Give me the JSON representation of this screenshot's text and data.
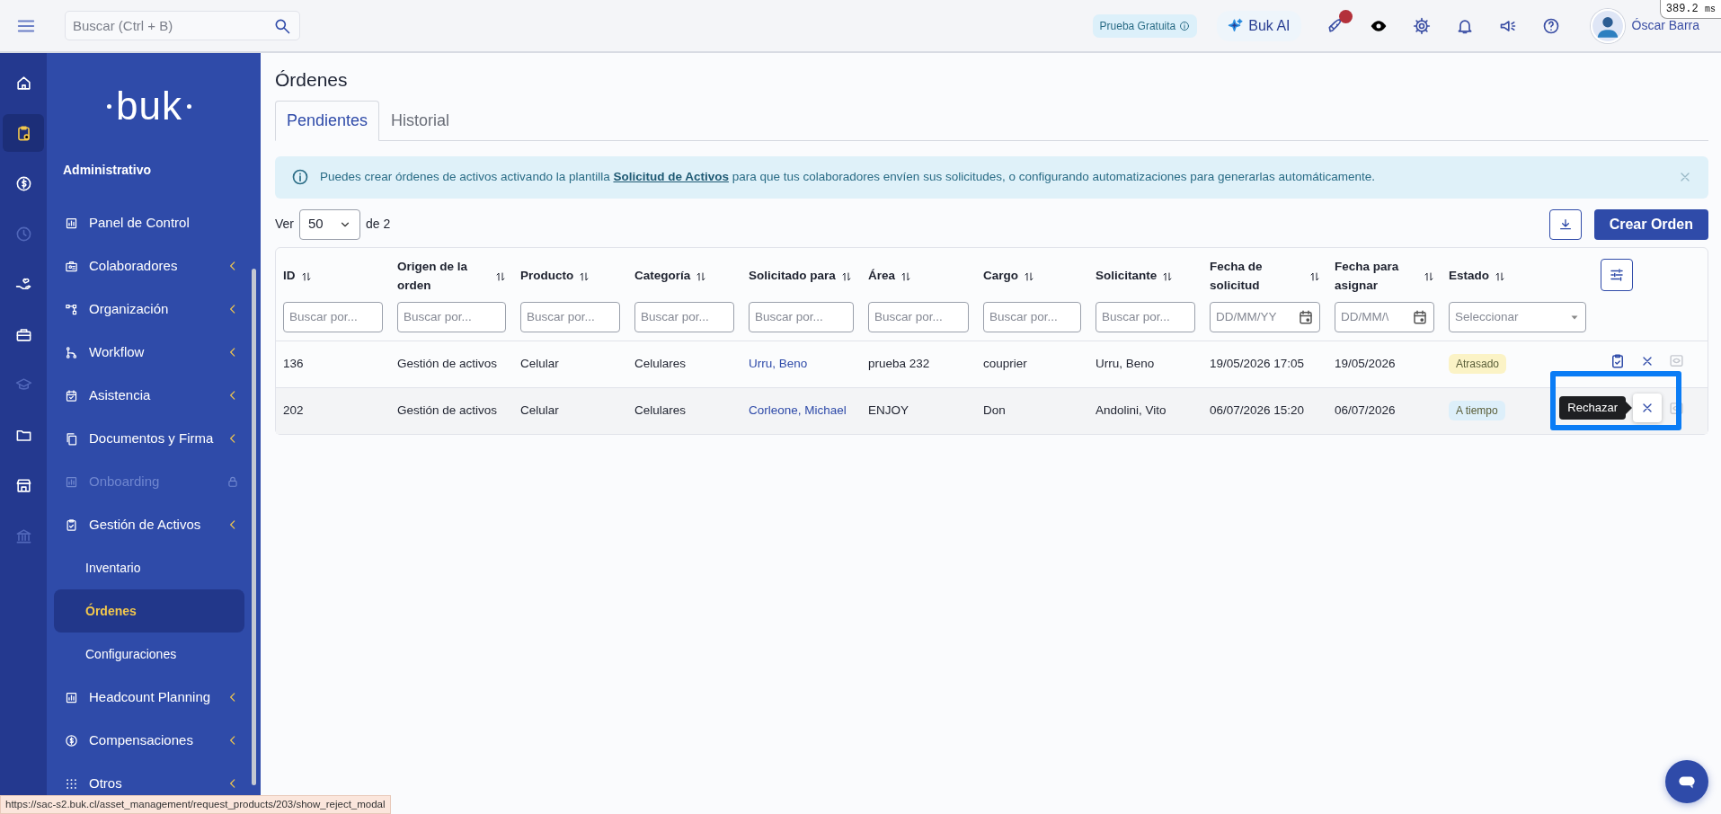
{
  "topbar": {
    "search_placeholder": "Buscar (Ctrl + B)",
    "trial_badge": "Prueba Gratuita",
    "ai_button": "Buk AI",
    "rocket_notification": true,
    "user_name": "Óscar Barra"
  },
  "perf_badge": {
    "value": "389.2",
    "unit": "ms"
  },
  "rail": [
    {
      "selected": false,
      "disabled": false
    },
    {
      "selected": true,
      "disabled": false
    },
    {
      "selected": false,
      "disabled": false
    },
    {
      "selected": false,
      "disabled": true
    },
    {
      "selected": false,
      "disabled": false
    },
    {
      "selected": false,
      "disabled": false
    },
    {
      "selected": false,
      "disabled": true
    },
    {
      "selected": false,
      "disabled": false
    },
    {
      "selected": false,
      "disabled": false
    },
    {
      "selected": false,
      "disabled": true
    }
  ],
  "sidebar": {
    "logo": "buk",
    "section": "Administrativo",
    "items": [
      {
        "label": "Panel de Control",
        "has_submenu": false,
        "disabled": false,
        "locked": false
      },
      {
        "label": "Colaboradores",
        "has_submenu": true,
        "disabled": false,
        "locked": false
      },
      {
        "label": "Organización",
        "has_submenu": true,
        "disabled": false,
        "locked": false
      },
      {
        "label": "Workflow",
        "has_submenu": true,
        "disabled": false,
        "locked": false
      },
      {
        "label": "Asistencia",
        "has_submenu": true,
        "disabled": false,
        "locked": false
      },
      {
        "label": "Documentos y Firma",
        "has_submenu": true,
        "disabled": false,
        "locked": false
      },
      {
        "label": "Onboarding",
        "has_submenu": false,
        "disabled": true,
        "locked": true
      },
      {
        "label": "Gestión de Activos",
        "has_submenu": true,
        "disabled": false,
        "locked": false,
        "children": [
          {
            "label": "Inventario",
            "selected": false
          },
          {
            "label": "Órdenes",
            "selected": true
          },
          {
            "label": "Configuraciones",
            "selected": false
          }
        ]
      },
      {
        "label": "Headcount Planning",
        "has_submenu": true,
        "disabled": false,
        "locked": false
      },
      {
        "label": "Compensaciones",
        "has_submenu": true,
        "disabled": false,
        "locked": false
      },
      {
        "label": "Otros",
        "has_submenu": true,
        "disabled": false,
        "locked": false
      }
    ]
  },
  "page": {
    "title": "Órdenes",
    "tabs": [
      {
        "label": "Pendientes",
        "selected": true
      },
      {
        "label": "Historial",
        "selected": false
      }
    ],
    "alert": {
      "text_before": "Puedes crear órdenes de activos activando la plantilla",
      "link": "Solicitud de Activos",
      "text_after": "para que tus colaboradores envíen sus solicitudes, o configurando automatizaciones para generarlas automáticamente."
    },
    "pager": {
      "prefix": "Ver",
      "value": "50",
      "suffix": "de 2"
    },
    "create_button": "Crear Orden"
  },
  "table": {
    "columns": [
      {
        "label": "ID",
        "kind": "text",
        "filter": {
          "kind": "text",
          "placeholder": "Buscar por..."
        }
      },
      {
        "label": "Origen de la orden",
        "kind": "text",
        "filter": {
          "kind": "text",
          "placeholder": "Buscar por..."
        }
      },
      {
        "label": "Producto",
        "kind": "text",
        "filter": {
          "kind": "text",
          "placeholder": "Buscar por..."
        }
      },
      {
        "label": "Categoría",
        "kind": "text",
        "filter": {
          "kind": "text",
          "placeholder": "Buscar por..."
        }
      },
      {
        "label": "Solicitado para",
        "kind": "link",
        "filter": {
          "kind": "text",
          "placeholder": "Buscar por..."
        }
      },
      {
        "label": "Área",
        "kind": "text",
        "filter": {
          "kind": "text",
          "placeholder": "Buscar por..."
        }
      },
      {
        "label": "Cargo",
        "kind": "text",
        "filter": {
          "kind": "text",
          "placeholder": "Buscar por..."
        }
      },
      {
        "label": "Solicitante",
        "kind": "text",
        "filter": {
          "kind": "text",
          "placeholder": "Buscar por..."
        }
      },
      {
        "label": "Fecha de solicitud",
        "kind": "text",
        "filter": {
          "kind": "date",
          "placeholder": "DD/MM/YY"
        }
      },
      {
        "label": "Fecha para asignar",
        "kind": "text",
        "filter": {
          "kind": "date",
          "placeholder": "DD/MM/\\"
        }
      },
      {
        "label": "Estado",
        "kind": "status",
        "filter": {
          "kind": "select",
          "placeholder": "Seleccionar"
        }
      }
    ],
    "rows": [
      {
        "cells": [
          "136",
          "Gestión de activos",
          "Celular",
          "Celulares",
          "Urru, Beno",
          "prueba 232",
          "couprier",
          "Urru, Beno",
          "19/05/2026 17:05",
          "19/05/2026",
          "Atrasado"
        ],
        "color": "#fbf3c6",
        "hovered": false
      },
      {
        "cells": [
          "202",
          "Gestión de activos",
          "Celular",
          "Celulares",
          "Corleone, Michael",
          "ENJOY",
          "Don",
          "Andolini, Vito",
          "06/07/2026 15:20",
          "06/07/2026",
          "A tiempo"
        ],
        "color": "#ddeffa",
        "hovered": true,
        "tooltip": "Rechazar"
      }
    ]
  },
  "status_url": "https://sac-s2.buk.cl/asset_management/request_products/203/show_reject_modal"
}
